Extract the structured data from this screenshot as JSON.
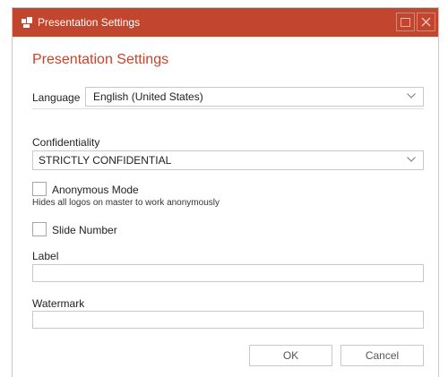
{
  "window": {
    "title": "Presentation Settings",
    "accent_color": "#c2452d",
    "icons": [
      "app-icon",
      "maximize-icon",
      "close-icon"
    ]
  },
  "dialog": {
    "heading": "Presentation Settings",
    "language": {
      "label": "Language",
      "value": "English (United States)"
    },
    "confidentiality": {
      "label": "Confidentiality",
      "value": "STRICTLY CONFIDENTIAL"
    },
    "anonymous_mode": {
      "label": "Anonymous Mode",
      "hint": "Hides all logos on master to work anonymously",
      "checked": false
    },
    "slide_number": {
      "label": "Slide Number",
      "checked": false
    },
    "label_field": {
      "label": "Label",
      "value": ""
    },
    "watermark_field": {
      "label": "Watermark",
      "value": ""
    },
    "buttons": {
      "ok": "OK",
      "cancel": "Cancel"
    }
  }
}
